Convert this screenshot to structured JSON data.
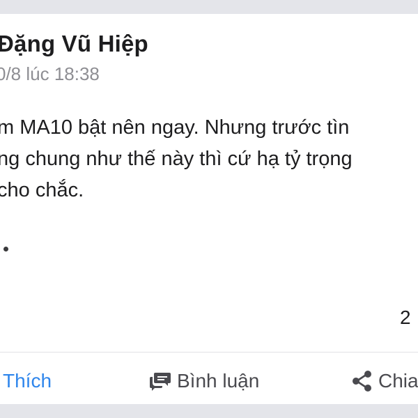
{
  "post": {
    "author": "Đặng Vũ Hiệp",
    "timestamp": "0/8 lúc 18:38",
    "body_lines": [
      "m MA10 bật nên ngay. Nhưng trước tìn",
      "ng chung như thế này thì cứ hạ tỷ trọng",
      "cho chắc."
    ],
    "count": "2"
  },
  "actions": {
    "like_label": "Thích",
    "comment_label": "Bình luận",
    "share_label": "Chia"
  },
  "icons": {
    "comment": "comment-bubbles-icon",
    "share": "share-icon"
  },
  "colors": {
    "background": "#e4e5ea",
    "card": "#ffffff",
    "like_accent": "#2f86ec",
    "text": "#1d1d1f",
    "muted": "#8e8e93"
  }
}
